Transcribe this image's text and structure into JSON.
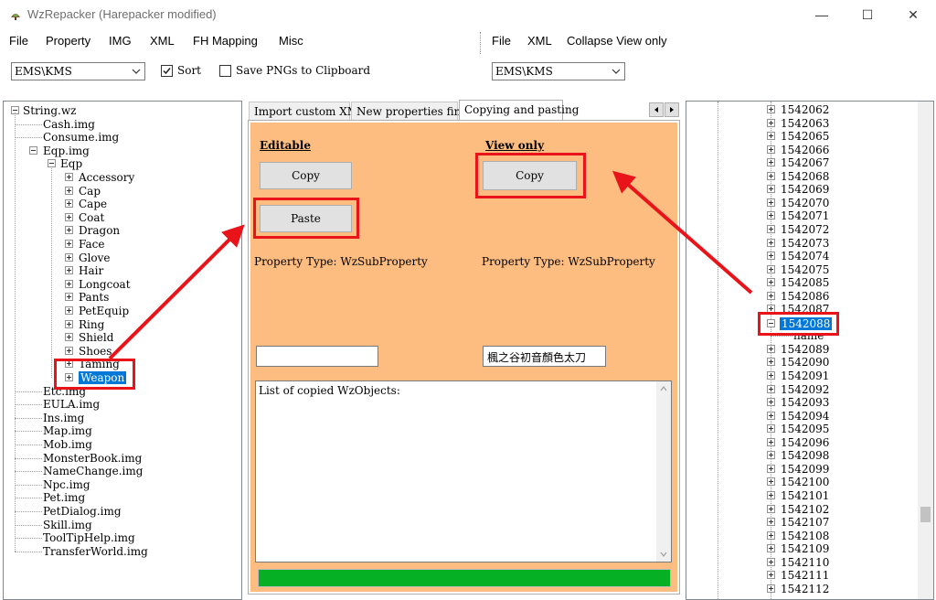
{
  "window": {
    "title": "WzRepacker (Harepacker modified)",
    "minimize": "—",
    "maximize": "☐",
    "close": "✕"
  },
  "menu_left": [
    "File",
    "Property",
    "IMG",
    "XML",
    "FH Mapping",
    "Misc"
  ],
  "menu_right": [
    "File",
    "XML",
    "Collapse View only"
  ],
  "toolbar": {
    "left_combo": "EMS\\KMS",
    "sort_label": "Sort",
    "sort_checked": true,
    "save_png_label": "Save PNGs to Clipboard",
    "save_png_checked": false,
    "right_combo": "EMS\\KMS"
  },
  "left_tree": {
    "root": "String.wz",
    "items_top": [
      "Cash.img",
      "Consume.img"
    ],
    "eqp_img": "Eqp.img",
    "eqp": "Eqp",
    "eqp_children": [
      "Accessory",
      "Cap",
      "Cape",
      "Coat",
      "Dragon",
      "Face",
      "Glove",
      "Hair",
      "Longcoat",
      "Pants",
      "PetEquip",
      "Ring",
      "Shield",
      "Shoes",
      "Taming"
    ],
    "selected": "Weapon",
    "items_bottom": [
      "Etc.img",
      "EULA.img",
      "Ins.img",
      "Map.img",
      "Mob.img",
      "MonsterBook.img",
      "NameChange.img",
      "Npc.img",
      "Pet.img",
      "PetDialog.img",
      "Skill.img",
      "ToolTipHelp.img",
      "TransferWorld.img"
    ]
  },
  "tabs": [
    "Import custom XML",
    "New properties finder",
    "Copying and pasting"
  ],
  "center": {
    "editable_label": "Editable",
    "view_only_label": "View only",
    "copy_editable": "Copy",
    "paste": "Paste",
    "copy_view": "Copy",
    "prop_type_editable": "Property Type: WzSubProperty",
    "prop_type_view": "Property Type: WzSubProperty",
    "editable_name": "",
    "view_name": "楓之谷初音顏色太刀",
    "copied_list_label": "List of copied WzObjects:"
  },
  "right_tree": {
    "items_before": [
      "1542062",
      "1542063",
      "1542065",
      "1542066",
      "1542067",
      "1542068",
      "1542069",
      "1542070",
      "1542071",
      "1542072",
      "1542073",
      "1542074",
      "1542075",
      "1542085",
      "1542086",
      "1542087"
    ],
    "selected": "1542088",
    "child": "name",
    "items_after": [
      "1542089",
      "1542090",
      "1542091",
      "1542092",
      "1542093",
      "1542094",
      "1542095",
      "1542096",
      "1542098",
      "1542099",
      "1542100",
      "1542101",
      "1542102",
      "1542107",
      "1542108",
      "1542109",
      "1542110",
      "1542111",
      "1542112"
    ]
  },
  "colors": {
    "panel_bg": "#fdbc80",
    "progress": "#06b025",
    "highlight": "#e8141a",
    "selection": "#0078d7"
  }
}
